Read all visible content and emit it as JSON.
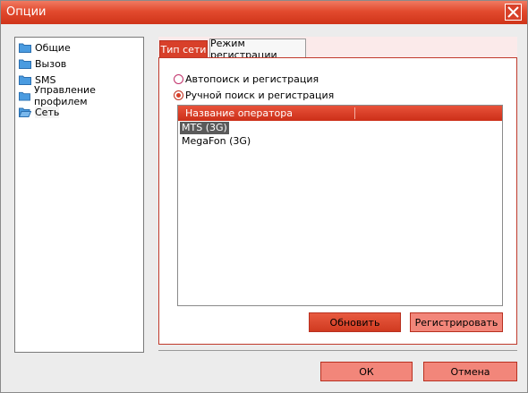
{
  "window": {
    "title": "Опции"
  },
  "sidebar": {
    "items": [
      {
        "label": "Общие"
      },
      {
        "label": "Вызов"
      },
      {
        "label": "SMS"
      },
      {
        "label": "Управление профилем"
      },
      {
        "label": "Сеть"
      }
    ],
    "selected": "Сеть"
  },
  "tabs": [
    {
      "label": "Тип сети"
    },
    {
      "label": "Режим регистрации"
    }
  ],
  "registration": {
    "options": [
      {
        "label": "Автопоиск и регистрация",
        "checked": false
      },
      {
        "label": "Ручной поиск и регистрация",
        "checked": true
      }
    ],
    "list_header": "Название оператора",
    "operators": [
      {
        "name": "MTS (3G)",
        "selected": true
      },
      {
        "name": "MegaFon (3G)",
        "selected": false
      }
    ],
    "refresh_label": "Обновить",
    "register_label": "Регистрировать"
  },
  "footer": {
    "ok_label": "ОК",
    "cancel_label": "Отмена"
  },
  "colors": {
    "accent": "#d8402a",
    "folder": "#3a8fd8"
  }
}
